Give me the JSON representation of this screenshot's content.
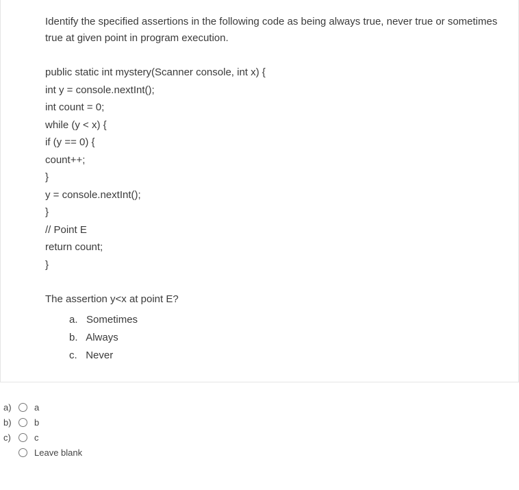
{
  "question": {
    "intro": "Identify the specified assertions in the following code as being always true, never true or sometimes true at given point in program execution.",
    "code": [
      "public static int mystery(Scanner console, int x) {",
      "int y = console.nextInt();",
      "int count = 0;",
      "while (y < x) {",
      "if (y == 0) {",
      "count++;",
      "}",
      "y = console.nextInt();",
      "}",
      "// Point E",
      "return count;",
      "}"
    ],
    "assertion_question": "The assertion y<x at point E?",
    "assertion_options": [
      {
        "label": "a.",
        "text": "Sometimes"
      },
      {
        "label": "b.",
        "text": "Always"
      },
      {
        "label": "c.",
        "text": "Never"
      }
    ]
  },
  "answers": [
    {
      "label": "a)",
      "text": "a"
    },
    {
      "label": "b)",
      "text": "b"
    },
    {
      "label": "c)",
      "text": "c"
    }
  ],
  "leave_blank": "Leave blank"
}
